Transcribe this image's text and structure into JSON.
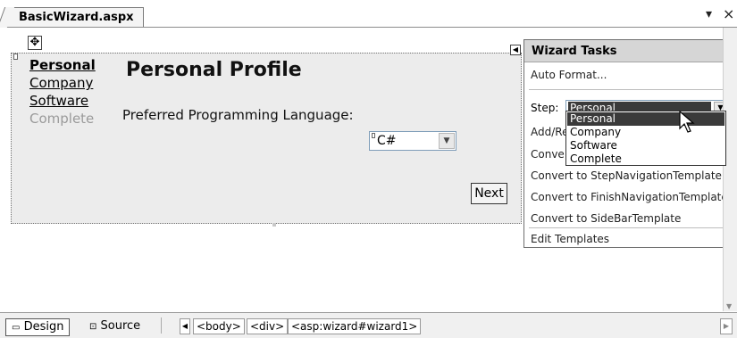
{
  "tab": {
    "title": "BasicWizard.aspx",
    "dropdown_icon": "▾",
    "close_icon": "×"
  },
  "wizard": {
    "sidebar": [
      {
        "label": "Personal",
        "enabled": true
      },
      {
        "label": "Company",
        "enabled": true
      },
      {
        "label": "Software",
        "enabled": true
      },
      {
        "label": "Complete",
        "enabled": false
      }
    ],
    "step_title": "Personal Profile",
    "field_label": "Preferred Programming Language:",
    "language_value": "C#",
    "next_label": "Next"
  },
  "tasks": {
    "header": "Wizard Tasks",
    "auto_format": "Auto Format...",
    "step_label": "Step:",
    "step_value": "Personal",
    "add_remove": "Add/Re",
    "convert_start": "Conve",
    "convert_step_partial": "Convert to StepNavigationTemplate",
    "convert_finish": "Convert to FinishNavigationTemplate",
    "convert_sidebar": "Convert to SideBarTemplate",
    "edit_templates": "Edit Templates",
    "step_options": [
      "Personal",
      "Company",
      "Software",
      "Complete"
    ]
  },
  "bottom": {
    "design_tab": "Design",
    "source_tab": "Source",
    "breadcrumbs": [
      "<body>",
      "<div>",
      "<asp:wizard#wizard1>"
    ]
  }
}
